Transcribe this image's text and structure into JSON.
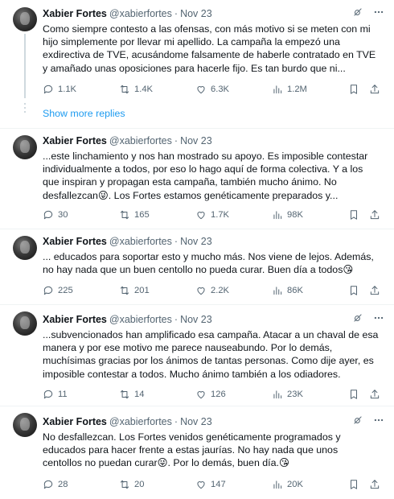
{
  "show_more_label": "Show more replies",
  "tweets": [
    {
      "name": "Xabier Fortes",
      "handle": "@xabierfortes",
      "sep": "·",
      "time": "Nov 23",
      "text": "Como siempre contesto a las ofensas, con más motivo si se meten con mi\nhijo simplemente por llevar mi apellido. La campaña la empezó una\nexdirectiva de TVE, acusándome falsamente de haberle contratado en TVE\ny amañado unas oposiciones para hacerle fijo. Es tan burdo que ni...",
      "replies": "1.1K",
      "reposts": "1.4K",
      "likes": "6.3K",
      "views": "1.2M"
    },
    {
      "name": "Xabier Fortes",
      "handle": "@xabierfortes",
      "sep": "·",
      "time": "Nov 23",
      "text": "...este linchamiento y nos han mostrado su apoyo. Es imposible contestar\nindividualmente a todos, por eso lo hago aquí de forma colectiva. Y a los\nque inspiran y propagan esta campaña, también mucho ánimo. No\ndesfallezcan😜. Los Fortes estamos genéticamente preparados y...",
      "replies": "30",
      "reposts": "165",
      "likes": "1.7K",
      "views": "98K"
    },
    {
      "name": "Xabier Fortes",
      "handle": "@xabierfortes",
      "sep": "·",
      "time": "Nov 23",
      "text": "... educados para soportar esto y mucho más. Nos viene de lejos. Además,\nno hay nada que un buen centollo no pueda curar. Buen día a todos😘",
      "replies": "225",
      "reposts": "201",
      "likes": "2.2K",
      "views": "86K"
    },
    {
      "name": "Xabier Fortes",
      "handle": "@xabierfortes",
      "sep": "·",
      "time": "Nov 23",
      "text": "...subvencionados han amplificado esa campaña. Atacar a un chaval de esa\nmanera y por ese motivo me parece nauseabundo. Por lo demás,\nmuchísimas gracias por los ánimos de tantas personas. Como dije ayer, es\nimposible contestar a todos. Mucho ánimo también a los odiadores.",
      "replies": "11",
      "reposts": "14",
      "likes": "126",
      "views": "23K"
    },
    {
      "name": "Xabier Fortes",
      "handle": "@xabierfortes",
      "sep": "·",
      "time": "Nov 23",
      "text": "No desfallezcan. Los Fortes venidos genéticamente programados y\neducados para hacer frente a estas jaurías. No hay nada que unos\ncentollos no puedan curar😜. Por lo demás, buen día.😘",
      "replies": "28",
      "reposts": "20",
      "likes": "147",
      "views": "20K"
    }
  ]
}
